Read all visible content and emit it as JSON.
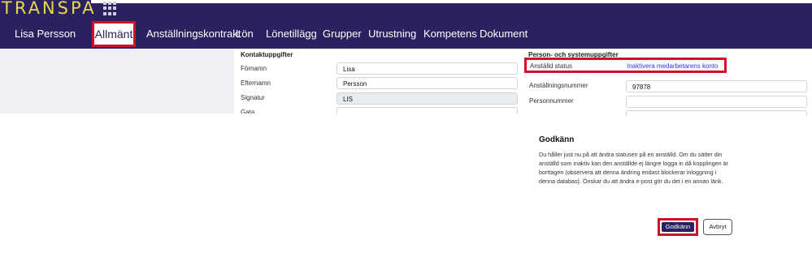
{
  "app": {
    "logo": "TRANSPA",
    "grid_icon": "app-grid-icon"
  },
  "navbar": {
    "user": "Lisa Persson",
    "items": [
      "Allmänt",
      "Anställningskontrakt",
      "Lön",
      "Lönetillägg",
      "Grupper",
      "Utrustning",
      "Kompetens",
      "Dokument"
    ]
  },
  "contact": {
    "title": "Kontaktuppgifter",
    "firstname_label": "Förnamn",
    "firstname": "Lisa",
    "lastname_label": "Efternamn",
    "lastname": "Persson",
    "signature_label": "Signatur",
    "signature": "LIS",
    "street_label": "Gata"
  },
  "person": {
    "title": "Person- och systemuppgifter",
    "status_label": "Anställd status",
    "status_link": "Inaktivera medarbetarens konto",
    "employee_no_label": "Anställningsnummer",
    "employee_no": "97878",
    "personal_no_label": "Personnummer"
  },
  "modal": {
    "title": "Godkänn",
    "text": "Du håller just nu på att ändra statusen på en anställd. Om du sätter din anställd som inaktiv kan den anställde ej längre logga in då kopplingen är borttagen (observera att denna ändring endast blockerar inloggning i denna databas). Önskar du att ändra e-post gör du det i en annan länk.",
    "ok": "Godkänn",
    "cancel": "Avbryt"
  },
  "colors": {
    "nav_bg": "#2b2160",
    "logo": "#e6d94a",
    "highlight": "#d0112b",
    "link": "#1a3cf5"
  }
}
